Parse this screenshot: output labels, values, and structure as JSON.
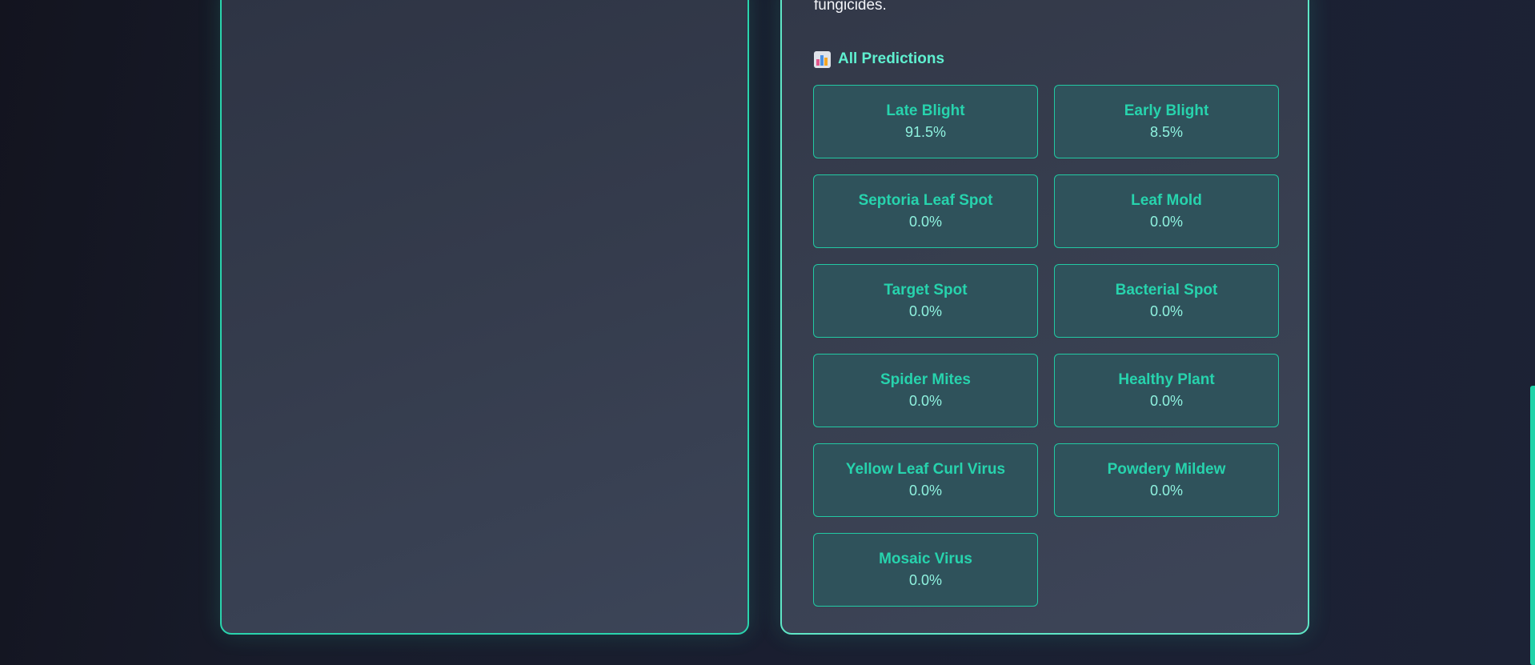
{
  "result": {
    "description_tail": "fungicides.",
    "predictions_heading": "All Predictions",
    "predictions_icon": "bar-chart-icon",
    "predictions": [
      {
        "name": "Late Blight",
        "value": "91.5%"
      },
      {
        "name": "Early Blight",
        "value": "8.5%"
      },
      {
        "name": "Septoria Leaf Spot",
        "value": "0.0%"
      },
      {
        "name": "Leaf Mold",
        "value": "0.0%"
      },
      {
        "name": "Target Spot",
        "value": "0.0%"
      },
      {
        "name": "Bacterial Spot",
        "value": "0.0%"
      },
      {
        "name": "Spider Mites",
        "value": "0.0%"
      },
      {
        "name": "Healthy Plant",
        "value": "0.0%"
      },
      {
        "name": "Yellow Leaf Curl Virus",
        "value": "0.0%"
      },
      {
        "name": "Powdery Mildew",
        "value": "0.0%"
      },
      {
        "name": "Mosaic Virus",
        "value": "0.0%"
      }
    ]
  },
  "colors": {
    "accent": "#2ad4ad",
    "card_background": "#2f525b",
    "heading": "#5ff0d0"
  }
}
